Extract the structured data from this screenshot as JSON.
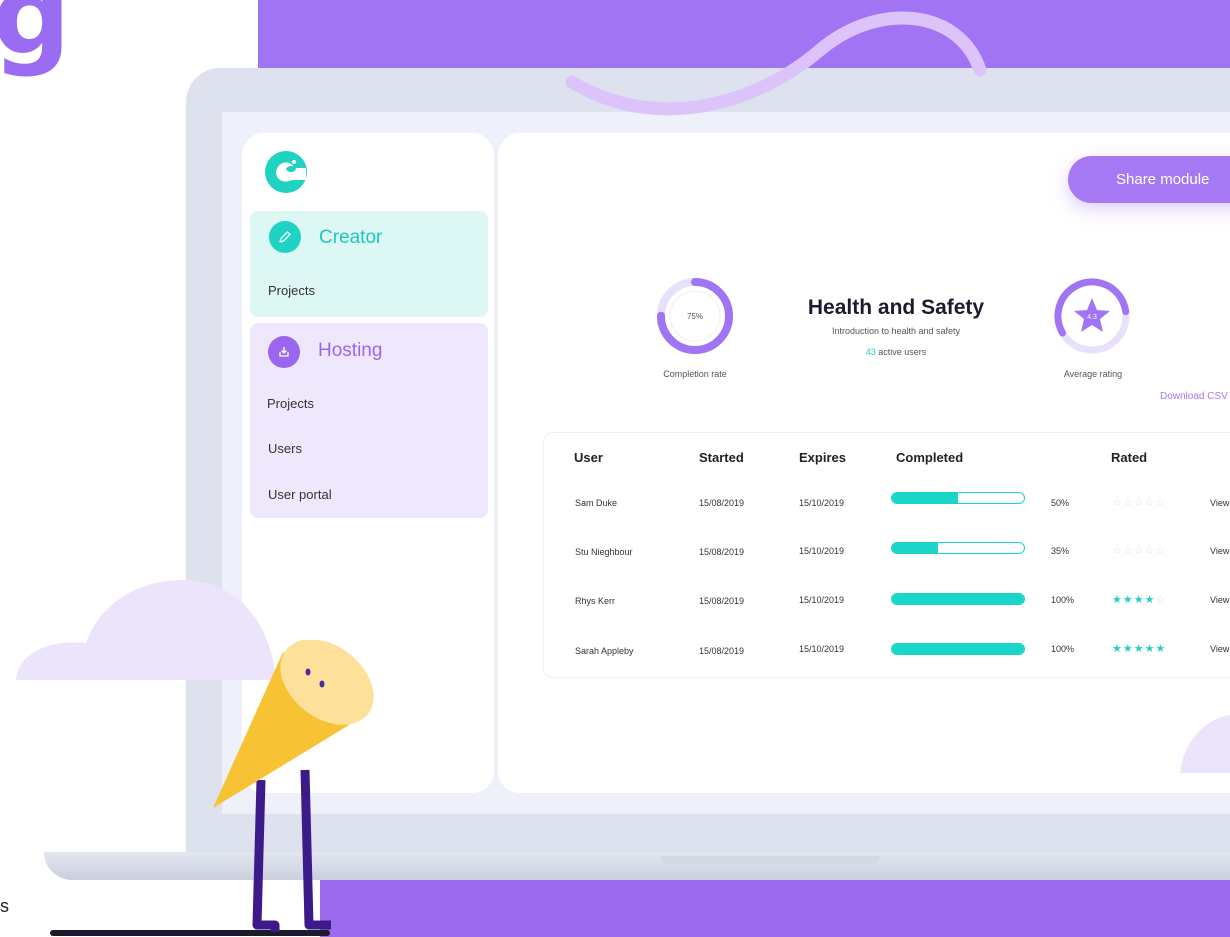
{
  "brand_letter": "g",
  "corner_letter": "s",
  "sidebar": {
    "creator": {
      "title": "Creator",
      "items": [
        "Projects"
      ]
    },
    "hosting": {
      "title": "Hosting",
      "items": [
        "Projects",
        "Users",
        "User portal"
      ]
    }
  },
  "header": {
    "share_label": "Share module"
  },
  "stats": {
    "completion": {
      "value": "75%",
      "fraction": 0.75,
      "label": "Completion rate"
    },
    "rating": {
      "value": "4.3",
      "label": "Average rating"
    }
  },
  "module": {
    "title": "Health and Safety",
    "subtitle": "Introduction to health and safety",
    "active_count": "43",
    "active_suffix": " active users"
  },
  "download_label": "Download CSV",
  "table": {
    "headers": [
      "User",
      "Started",
      "Expires",
      "Completed",
      "Rated"
    ],
    "rows": [
      {
        "user": "Sam Duke",
        "started": "15/08/2019",
        "expires": "15/10/2019",
        "progress": 0.5,
        "percent": "50%",
        "rating": 0,
        "view": "View"
      },
      {
        "user": "Stu Nieghbour",
        "started": "15/08/2019",
        "expires": "15/10/2019",
        "progress": 0.35,
        "percent": "35%",
        "rating": 0,
        "view": "View"
      },
      {
        "user": "Rhys Kerr",
        "started": "15/08/2019",
        "expires": "15/10/2019",
        "progress": 1,
        "percent": "100%",
        "rating": 4,
        "view": "View"
      },
      {
        "user": "Sarah Appleby",
        "started": "15/08/2019",
        "expires": "15/10/2019",
        "progress": 1,
        "percent": "100%",
        "rating": 5,
        "view": "View"
      }
    ]
  },
  "colors": {
    "accent": "#a174f4",
    "teal": "#1fd3c3",
    "background": "#eef1fa"
  },
  "icons": [
    "chameleon-logo-icon",
    "pencil-icon",
    "download-icon",
    "star-icon"
  ]
}
